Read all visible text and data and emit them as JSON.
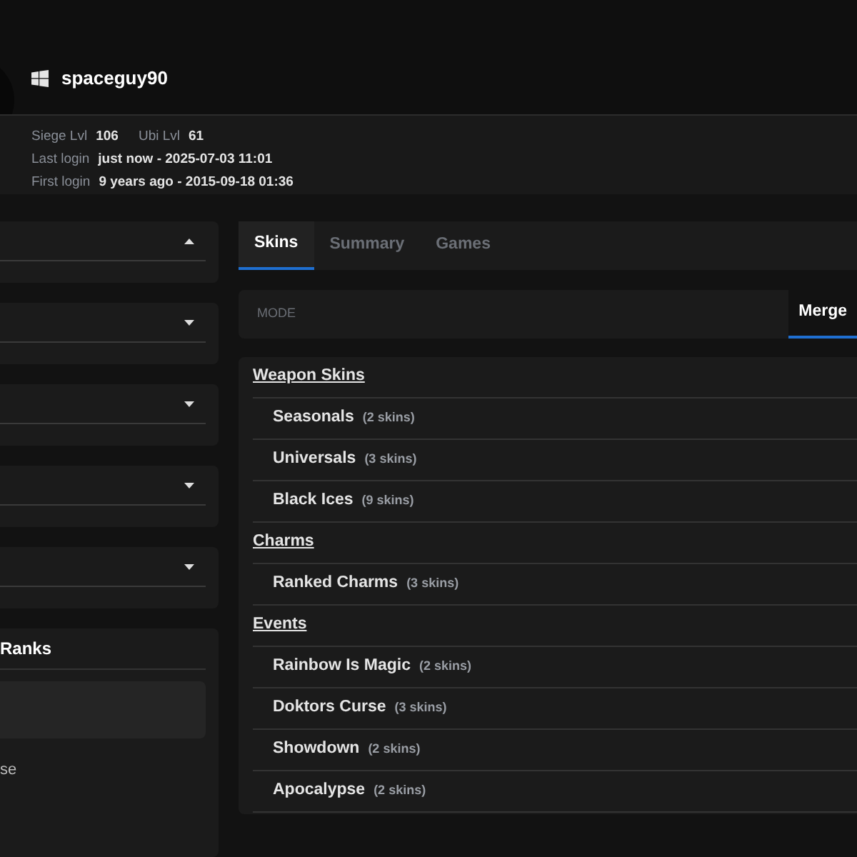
{
  "profile": {
    "username": "spaceguy90",
    "stats": [
      {
        "label": "Siege Lvl",
        "value": "106"
      },
      {
        "label": "Ubi Lvl",
        "value": "61"
      }
    ],
    "logins": [
      {
        "label": "Last login",
        "value": "just now - 2025-07-03 11:01"
      },
      {
        "label": "First login",
        "value": "9 years ago - 2015-09-18 01:36"
      }
    ]
  },
  "filters": [
    {
      "expanded": true
    },
    {
      "expanded": false
    },
    {
      "expanded": false
    },
    {
      "expanded": false
    },
    {
      "expanded": false
    }
  ],
  "ranks_panel": {
    "title": "Ranks",
    "item": "se"
  },
  "tabs": [
    {
      "label": "Skins",
      "selected": true
    },
    {
      "label": "Summary",
      "selected": false
    },
    {
      "label": "Games",
      "selected": false
    }
  ],
  "mode": {
    "label": "MODE",
    "options": [
      {
        "label": "Merge",
        "selected": true
      }
    ]
  },
  "skin_list": [
    {
      "kind": "category",
      "name": "Weapon Skins"
    },
    {
      "kind": "item",
      "name": "Seasonals",
      "count": "(2 skins)"
    },
    {
      "kind": "item",
      "name": "Universals",
      "count": "(3 skins)"
    },
    {
      "kind": "item",
      "name": "Black Ices",
      "count": "(9 skins)"
    },
    {
      "kind": "category",
      "name": "Charms"
    },
    {
      "kind": "item",
      "name": "Ranked Charms",
      "count": "(3 skins)"
    },
    {
      "kind": "category",
      "name": "Events"
    },
    {
      "kind": "item",
      "name": "Rainbow Is Magic",
      "count": "(2 skins)"
    },
    {
      "kind": "item",
      "name": "Doktors Curse",
      "count": "(3 skins)"
    },
    {
      "kind": "item",
      "name": "Showdown",
      "count": "(2 skins)"
    },
    {
      "kind": "item",
      "name": "Apocalypse",
      "count": "(2 skins)"
    }
  ]
}
